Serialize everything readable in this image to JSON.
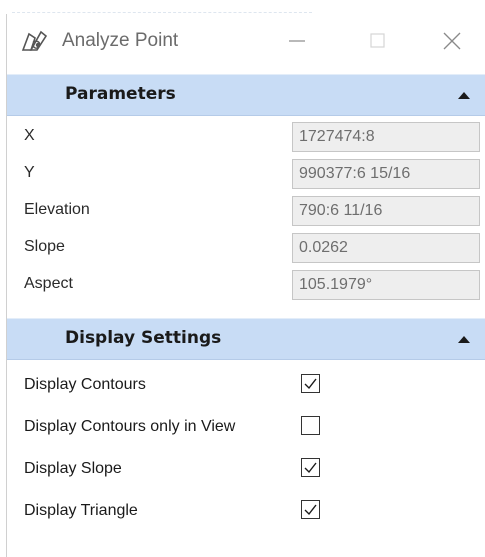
{
  "window": {
    "title": "Analyze Point"
  },
  "parameters": {
    "header": "Parameters",
    "rows": [
      {
        "label": "X",
        "value": "1727474:8"
      },
      {
        "label": "Y",
        "value": "990377:6 15/16"
      },
      {
        "label": "Elevation",
        "value": "790:6 11/16"
      },
      {
        "label": "Slope",
        "value": "0.0262"
      },
      {
        "label": "Aspect",
        "value": "105.1979°"
      }
    ]
  },
  "display_settings": {
    "header": "Display Settings",
    "rows": [
      {
        "label": "Display Contours",
        "checked": true
      },
      {
        "label": "Display Contours only in View",
        "checked": false
      },
      {
        "label": "Display Slope",
        "checked": true
      },
      {
        "label": "Display Triangle",
        "checked": true
      }
    ]
  },
  "colors": {
    "header_bg": "#c8dcf5",
    "field_bg": "#eeeeee"
  }
}
